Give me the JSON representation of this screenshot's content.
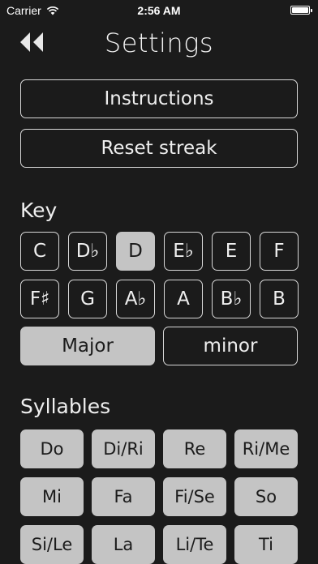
{
  "status_bar": {
    "carrier": "Carrier",
    "time": "2:56 AM"
  },
  "header": {
    "back_icon": "rewind-icon",
    "title": "Settings"
  },
  "actions": {
    "instructions_label": "Instructions",
    "reset_streak_label": "Reset streak"
  },
  "key_section": {
    "label": "Key",
    "selected": "D",
    "keys": [
      "C",
      "D♭",
      "D",
      "E♭",
      "E",
      "F",
      "F♯",
      "G",
      "A♭",
      "A",
      "B♭",
      "B"
    ],
    "modes": [
      "Major",
      "minor"
    ],
    "selected_mode": "Major"
  },
  "syllables_section": {
    "label": "Syllables",
    "items": [
      "Do",
      "Di/Ri",
      "Re",
      "Ri/Me",
      "Mi",
      "Fa",
      "Fi/Se",
      "So",
      "Si/Le",
      "La",
      "Li/Te",
      "Ti"
    ]
  },
  "colors": {
    "background": "#1b1b1b",
    "selected_fill": "#c4c4c4",
    "outline": "#d8d8d8"
  }
}
